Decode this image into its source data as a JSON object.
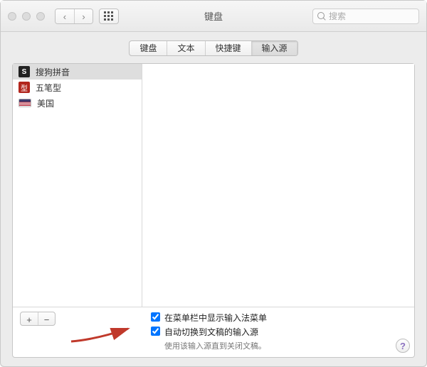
{
  "window": {
    "title": "键盘"
  },
  "search": {
    "placeholder": "搜索"
  },
  "tabs": [
    {
      "label": "键盘"
    },
    {
      "label": "文本"
    },
    {
      "label": "快捷键"
    },
    {
      "label": "输入源"
    }
  ],
  "active_tab_index": 3,
  "sources": [
    {
      "icon": "sogou",
      "glyph": "S",
      "label": "搜狗拼音",
      "selected": true
    },
    {
      "icon": "wubi",
      "glyph": "型",
      "label": "五笔型",
      "selected": false
    },
    {
      "icon": "flag",
      "glyph": "",
      "label": "美国",
      "selected": false
    }
  ],
  "buttons": {
    "add": "+",
    "remove": "−"
  },
  "options": {
    "show_menu": {
      "label": "在菜单栏中显示输入法菜单",
      "checked": true
    },
    "auto_switch": {
      "label": "自动切换到文稿的输入源",
      "help": "使用该输入源直到关闭文稿。",
      "checked": true
    }
  },
  "icons": {
    "back": "‹",
    "forward": "›",
    "help": "?"
  }
}
